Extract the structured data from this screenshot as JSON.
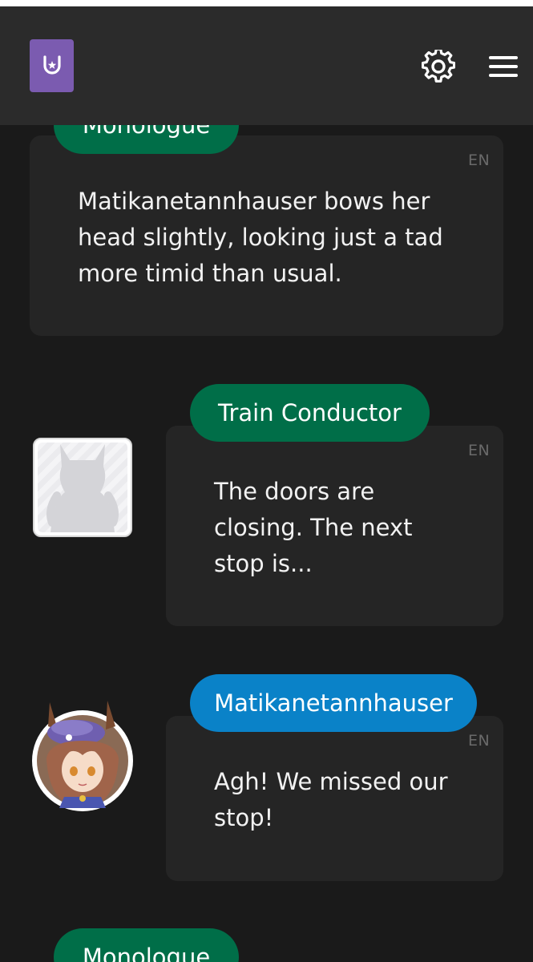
{
  "header": {
    "logo_icon": "horseshoe-star-icon",
    "settings_icon": "gear-icon",
    "menu_icon": "hamburger-menu-icon"
  },
  "messages": [
    {
      "speaker": "Monologue",
      "lang": "EN",
      "text_lines": [
        "Matikanetannhauser bows her",
        "head slightly, looking just a tad",
        "more timid than usual."
      ]
    },
    {
      "speaker": "Train Conductor",
      "lang": "EN",
      "avatar": "placeholder-silhouette-avatar",
      "text_lines": [
        "The doors are",
        "closing. The next",
        "stop is..."
      ]
    },
    {
      "speaker": "Matikanetannhauser",
      "lang": "EN",
      "avatar": "matikanetannhauser-portrait-avatar",
      "text_lines": [
        "Agh! We missed our",
        "stop!"
      ]
    },
    {
      "speaker": "Monologue"
    }
  ],
  "colors": {
    "background": "#1a1a1a",
    "header": "#2b2b2b",
    "card": "#252525",
    "monologue_tag": "#006e48",
    "npc_tag": "#006e48",
    "character_tag": "#0a82c8",
    "logo": "#7b5bb0"
  }
}
